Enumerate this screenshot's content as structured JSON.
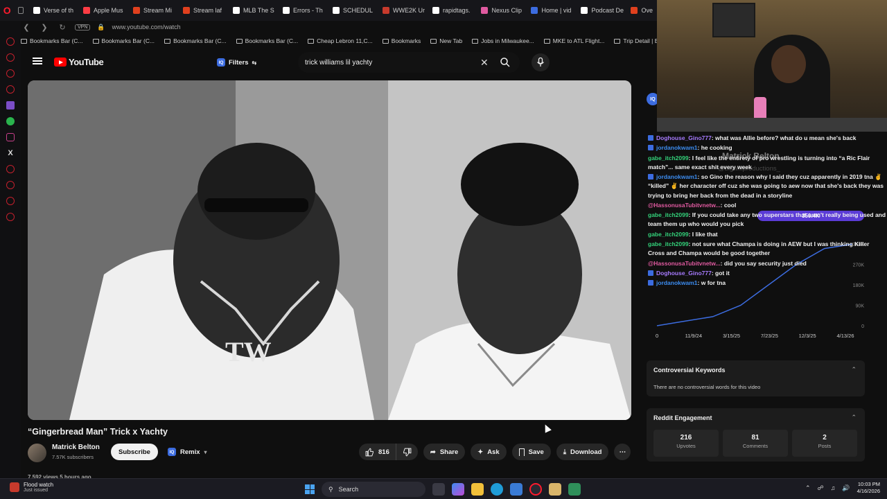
{
  "browser": {
    "tabs": [
      {
        "label": "Verse of th",
        "color": "#ffffff"
      },
      {
        "label": "Apple Mus",
        "color": "#fc3c44"
      },
      {
        "label": "Stream Mi",
        "color": "#e0401e"
      },
      {
        "label": "Stream laf",
        "color": "#e0401e"
      },
      {
        "label": "MLB The S",
        "color": "#ffffff"
      },
      {
        "label": "Errors - Th",
        "color": "#ffffff"
      },
      {
        "label": "SCHEDUL",
        "color": "#ffffff"
      },
      {
        "label": "WWE2K Ur",
        "color": "#c73a2c"
      },
      {
        "label": "rapidtags.",
        "color": "#ffffff"
      },
      {
        "label": "Nexus Clip",
        "color": "#e05aa0"
      },
      {
        "label": "Home | vid",
        "color": "#3c6ce0"
      },
      {
        "label": "Podcast De",
        "color": "#ffffff"
      },
      {
        "label": "Ove",
        "color": "#e0401e"
      }
    ],
    "vpn_label": "VPN",
    "url": "www.youtube.com/watch",
    "bookmarks": [
      "Bookmarks Bar (C...",
      "Bookmarks Bar (C...",
      "Bookmarks Bar (C...",
      "Bookmarks Bar (C...",
      "Cheap Lebron 11,C...",
      "Bookmarks",
      "New Tab",
      "Jobs in Milwaukee...",
      "MKE to ATL Flight...",
      "Trip Detail | Ex"
    ]
  },
  "youtube": {
    "logo_text": "YouTube",
    "filters_label": "Filters",
    "iq_label": "IQ",
    "search_value": "trick williams lil yachty",
    "video": {
      "title": "“Gingerbread Man” Trick x Yachty",
      "channel": "Matrick Belton",
      "subscribers": "7.57K subscribers",
      "subscribe_label": "Subscribe",
      "remix_label": "Remix",
      "likes": "816",
      "share_label": "Share",
      "ask_label": "Ask",
      "save_label": "Save",
      "download_label": "Download",
      "views_line": "7,592 views  5 hours ago"
    }
  },
  "chat": [
    {
      "user": "Doghouse_Gino777",
      "color": "#a77bff",
      "icon": true,
      "msg": ": what was Allie before? what do u mean she's back"
    },
    {
      "user": "jordanokwam1",
      "color": "#3c8cf0",
      "icon": true,
      "msg": ": he cooking"
    },
    {
      "user": "gabe_itch2099",
      "color": "#33d17a",
      "icon": false,
      "msg": ": I feel like the entirety of pro wrestling is turning into “a Ric Flair match”... same exact shit every week"
    },
    {
      "user": "jordanokwam1",
      "color": "#3c8cf0",
      "icon": true,
      "msg": ": so Gino the reason why I said they cuz apparently in 2019 tna ✌️ “killed” ✌️ her character off cuz she was going to aew now that she's back they was trying to bring her back from the dead in a storyline"
    },
    {
      "user": "@HassonusaTubitvnetw...",
      "color": "#e05aa0",
      "icon": false,
      "msg": ": cool"
    },
    {
      "user": "gabe_itch2099",
      "color": "#33d17a",
      "icon": false,
      "msg": ": If you could take any two superstars that aren't really being used and team them up who would you pick"
    },
    {
      "user": "gabe_itch2099",
      "color": "#33d17a",
      "icon": false,
      "msg": ": I like that"
    },
    {
      "user": "gabe_itch2099",
      "color": "#33d17a",
      "icon": false,
      "msg": ": not sure what Champa is doing in AEW but I was thinking Killer Cross and Champa would be good together"
    },
    {
      "user": "@HassonusaTubitvnetw...",
      "color": "#e05aa0",
      "icon": false,
      "msg": ": did you say security just died"
    },
    {
      "user": "Doghouse_Gino777",
      "color": "#a77bff",
      "icon": true,
      "msg": ": got it"
    },
    {
      "user": "jordanokwam1",
      "color": "#3c8cf0",
      "icon": true,
      "msg": ": w for tna"
    }
  ],
  "overlay": {
    "channel_title": "Matrick Belton",
    "handle": "@bigwillproductions_",
    "value_badge": "359.4K"
  },
  "chart_data": {
    "type": "line",
    "title": "",
    "x": [
      "0",
      "11/9/24",
      "3/15/25",
      "7/23/25",
      "12/3/25",
      "4/13/26"
    ],
    "y_ticks": [
      "0",
      "90K",
      "180K",
      "270K",
      "360K"
    ],
    "ylim": [
      0,
      360000
    ],
    "series": [
      {
        "values": [
          0,
          20000,
          40000,
          90000,
          180000,
          270000,
          340000,
          359400
        ]
      }
    ],
    "line_color": "#3c6ce0",
    "grid": false
  },
  "cards": {
    "controversial": {
      "title": "Controversial Keywords",
      "text": "There are no controversial words for this video"
    },
    "reddit": {
      "title": "Reddit Engagement",
      "stats": [
        {
          "value": "216",
          "label": "Upvotes"
        },
        {
          "value": "81",
          "label": "Comments"
        },
        {
          "value": "2",
          "label": "Posts"
        }
      ]
    }
  },
  "taskbar": {
    "notif_title": "Flood watch",
    "notif_sub": "Just issued",
    "search_label": "Search",
    "time": "10:03 PM",
    "date": "4/16/2026"
  }
}
